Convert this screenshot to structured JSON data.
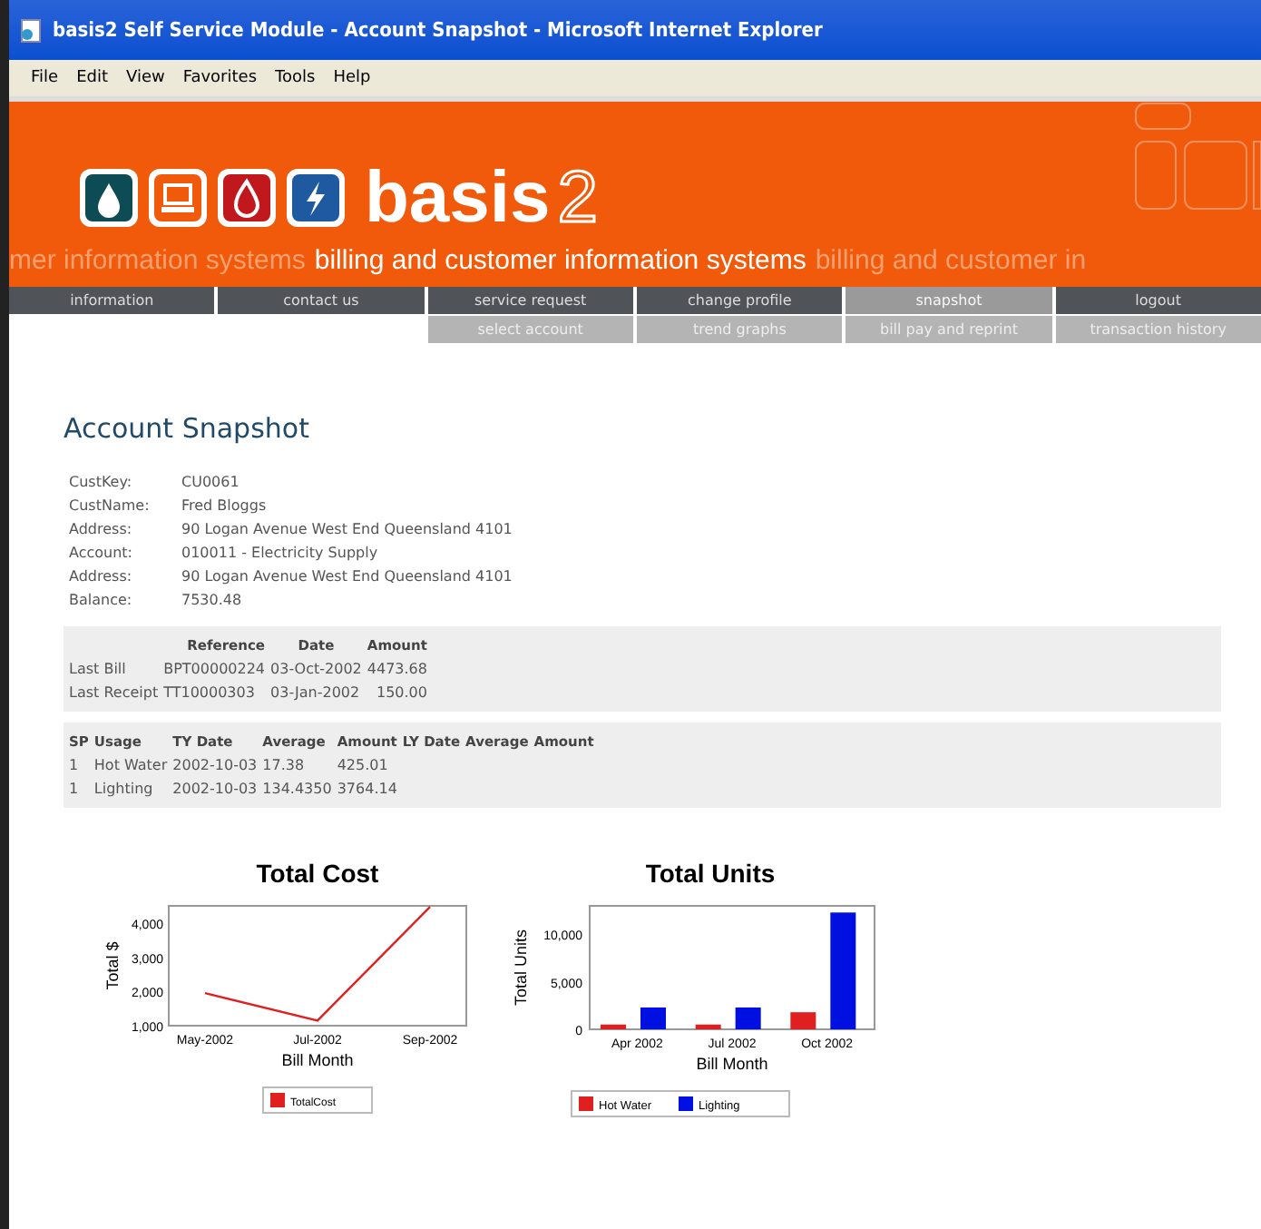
{
  "window": {
    "title": "basis2 Self Service Module - Account Snapshot - Microsoft Internet Explorer"
  },
  "menu": [
    "File",
    "Edit",
    "View",
    "Favorites",
    "Tools",
    "Help"
  ],
  "banner": {
    "brand": "basis",
    "brand_suffix": "2",
    "tagline": [
      {
        "text": "mer information systems",
        "bright": false
      },
      {
        "text": "billing and customer information systems",
        "bright": true
      },
      {
        "text": "billing and customer in",
        "bright": false
      }
    ]
  },
  "nav": [
    {
      "label": "information",
      "selected": false
    },
    {
      "label": "contact us",
      "selected": false
    },
    {
      "label": "service request",
      "selected": false
    },
    {
      "label": "change profile",
      "selected": false
    },
    {
      "label": "snapshot",
      "selected": true
    },
    {
      "label": "logout",
      "selected": false
    }
  ],
  "subnav": [
    "select account",
    "trend graphs",
    "bill pay and reprint",
    "transaction history"
  ],
  "heading": "Account Snapshot",
  "details": [
    {
      "label": "CustKey:",
      "value": "CU0061"
    },
    {
      "label": "CustName:",
      "value": "Fred Bloggs"
    },
    {
      "label": "Address:",
      "value": "90 Logan Avenue West End Queensland 4101"
    },
    {
      "label": "Account:",
      "value": "010011 - Electricity Supply"
    },
    {
      "label": "Address:",
      "value": "90 Logan Avenue West End Queensland 4101"
    },
    {
      "label": "Balance:",
      "value": "7530.48"
    }
  ],
  "bills": {
    "columns": [
      "",
      "Reference",
      "Date",
      "Amount"
    ],
    "rows": [
      [
        "Last Bill",
        "BPT00000224",
        "03-Oct-2002",
        "4473.68"
      ],
      [
        "Last Receipt",
        "TT10000303",
        "03-Jan-2002",
        "150.00"
      ]
    ]
  },
  "usage": {
    "columns": [
      "SP",
      "Usage",
      "TY Date",
      "Average",
      "Amount",
      "LY Date",
      "Average",
      "Amount"
    ],
    "rows": [
      [
        "1",
        "Hot Water",
        "2002-10-03",
        "17.38",
        "425.01"
      ],
      [
        "1",
        "Lighting",
        "2002-10-03",
        "134.4350",
        "3764.14"
      ]
    ]
  },
  "charts": [
    {
      "chart_data": {
        "type": "line",
        "title": "Total Cost",
        "xlabel": "Bill Month",
        "ylabel": "Total $",
        "categories": [
          "May-2002",
          "Jul-2002",
          "Sep-2002"
        ],
        "series": [
          {
            "name": "TotalCost",
            "color": "#e02020",
            "values": [
              1950,
              1150,
              4470
            ]
          }
        ],
        "legend": "bottom",
        "ylim": [
          1000,
          4500
        ],
        "yticks": [
          {
            "value": 1000,
            "label": "1,000"
          },
          {
            "value": 2000,
            "label": "2,000"
          },
          {
            "value": 3000,
            "label": "3,000"
          },
          {
            "value": 4000,
            "label": "4,000"
          }
        ]
      }
    },
    {
      "chart_data": {
        "type": "bar",
        "title": "Total Units",
        "xlabel": "Bill Month",
        "ylabel": "Total Units",
        "categories": [
          "Apr 2002",
          "Jul 2002",
          "Oct 2002"
        ],
        "series": [
          {
            "name": "Hot Water",
            "color": "#e02020",
            "values": [
              500,
              500,
              1800
            ]
          },
          {
            "name": "Lighting",
            "color": "#0010e0",
            "values": [
              2300,
              2300,
              12300
            ]
          }
        ],
        "legend": "bottom",
        "ylim": [
          0,
          13000
        ],
        "yticks": [
          {
            "value": 0,
            "label": "0"
          },
          {
            "value": 5000,
            "label": "5,000"
          },
          {
            "value": 10000,
            "label": "10,000"
          }
        ]
      }
    }
  ]
}
